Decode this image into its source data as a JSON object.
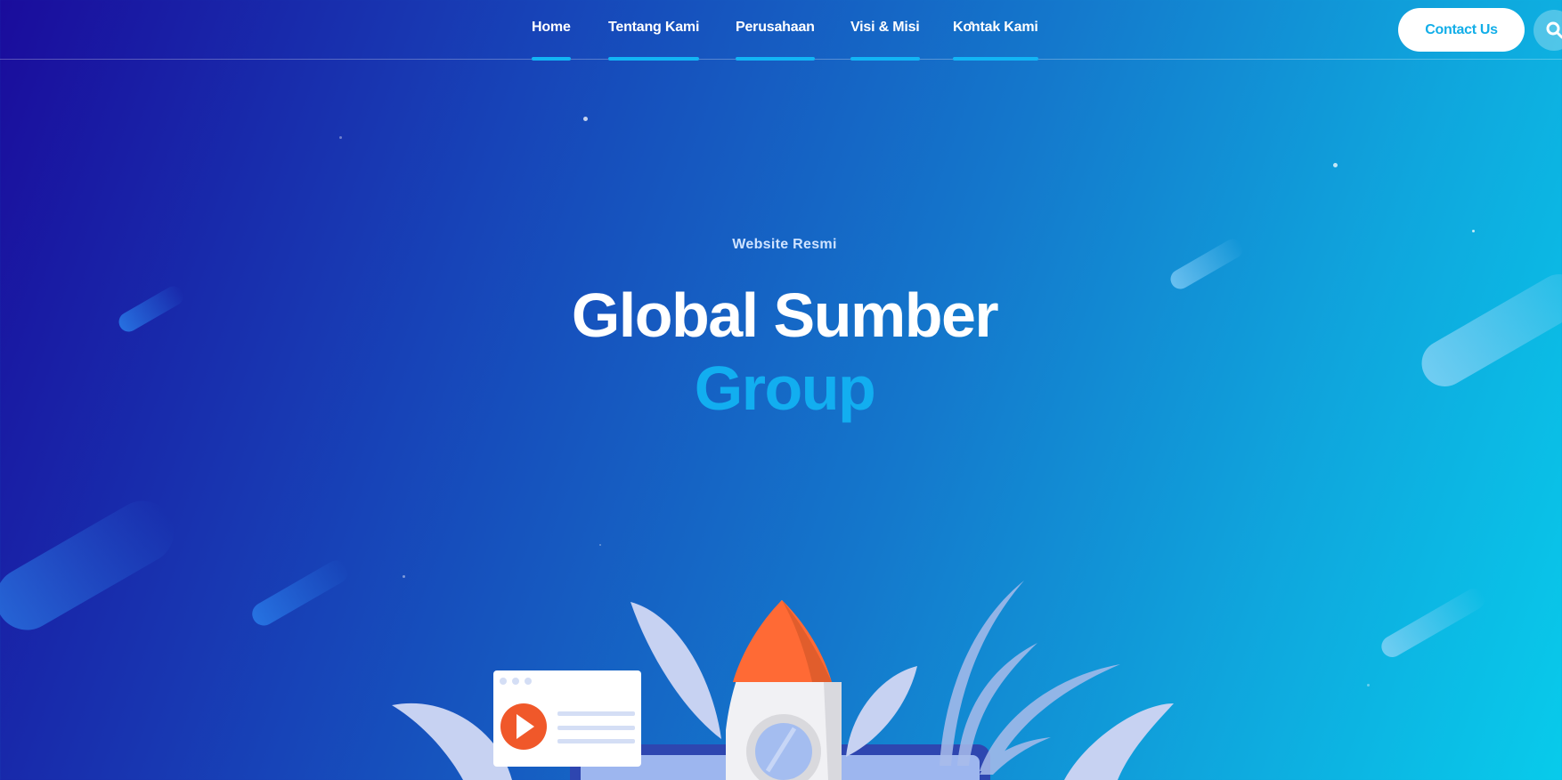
{
  "nav": {
    "items": [
      {
        "label": "Home"
      },
      {
        "label": "Tentang Kami"
      },
      {
        "label": "Perusahaan"
      },
      {
        "label": "Visi & Misi"
      },
      {
        "label": "Kontak Kami"
      }
    ],
    "contact_label": "Contact Us",
    "search_icon": "search-icon"
  },
  "hero": {
    "eyebrow": "Website Resmi",
    "title_line1": "Global Sumber",
    "title_line2": "Group"
  },
  "colors": {
    "accent": "#12AEF0",
    "underline": "#12B5F5",
    "rocket_tip": "#F26A3B",
    "play_button": "#F0582A"
  }
}
